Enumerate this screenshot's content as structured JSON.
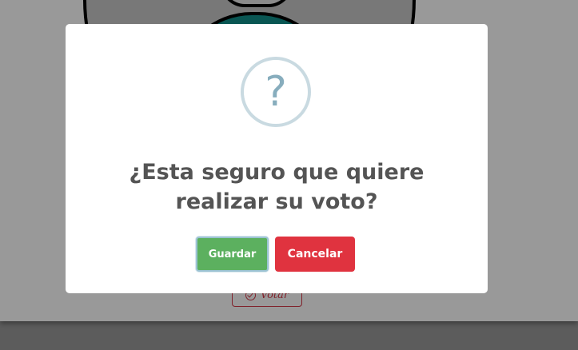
{
  "background": {
    "vote_button_label": "Votar",
    "vote_icon": "check-circle-icon"
  },
  "modal": {
    "icon": "question-mark-icon",
    "icon_glyph": "?",
    "title": "¿Esta seguro que quiere realizar su voto?",
    "confirm_label": "Guardar",
    "cancel_label": "Cancelar"
  },
  "colors": {
    "confirm": "#5cb05f",
    "cancel": "#e0333f",
    "question_icon": "#87adbd",
    "title_text": "#545454"
  }
}
